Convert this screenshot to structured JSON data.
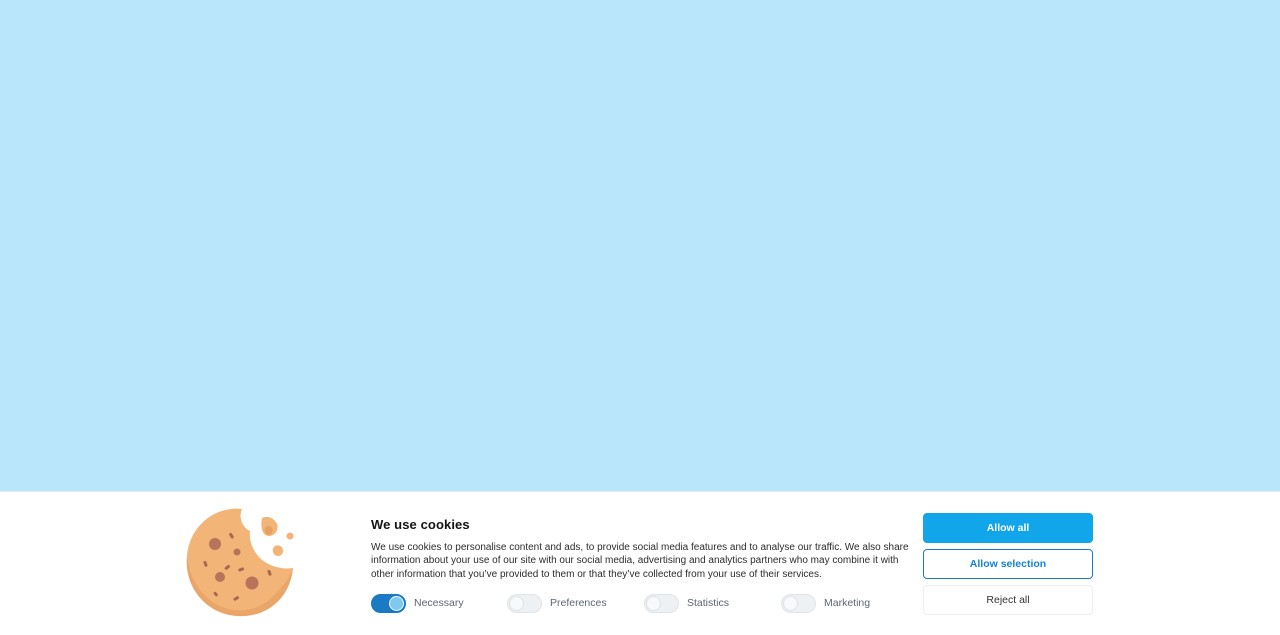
{
  "page": {
    "background_color": "#bae6fc"
  },
  "banner": {
    "title": "We use cookies",
    "description": "We use cookies to personalise content and ads, to provide social media features and to analyse our traffic. We also share information about your use of our site with our social media, advertising and analytics partners who may combine it with other information that you’ve provided to them or that they’ve collected from your use of their services.",
    "illustration_icon": "cookie-icon",
    "toggles": [
      {
        "label": "Necessary",
        "checked": true
      },
      {
        "label": "Preferences",
        "checked": false
      },
      {
        "label": "Statistics",
        "checked": false
      },
      {
        "label": "Marketing",
        "checked": false
      }
    ],
    "buttons": {
      "allow_all": "Allow all",
      "allow_selection": "Allow selection",
      "reject_all": "Reject all"
    },
    "colors": {
      "primary": "#11a5ea",
      "switch_on": "#1a7bc4",
      "cookie": "#f2b477"
    }
  }
}
